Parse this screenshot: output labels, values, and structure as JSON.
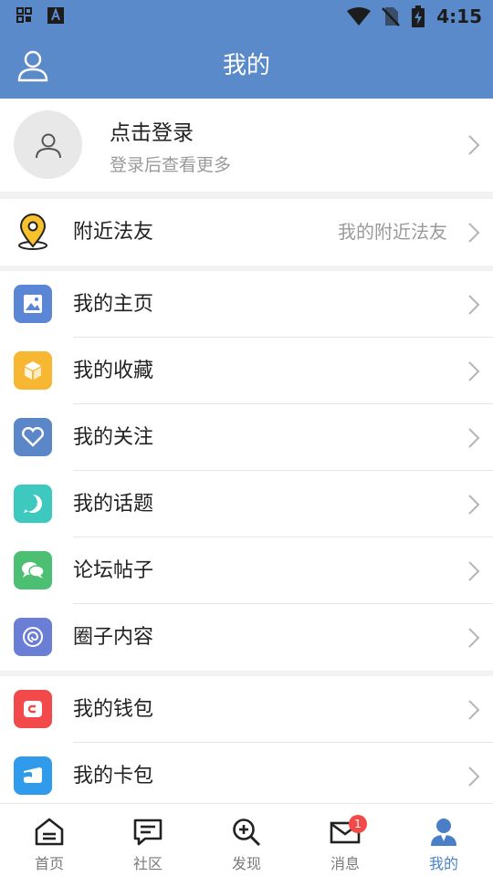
{
  "status": {
    "time": "4:15"
  },
  "header": {
    "title": "我的"
  },
  "login": {
    "title": "点击登录",
    "subtitle": "登录后查看更多"
  },
  "nearby": {
    "label": "附近法友",
    "sub": "我的附近法友"
  },
  "menu_group1": [
    {
      "label": "我的主页",
      "icon": "image-icon",
      "color": "#5b86d6"
    },
    {
      "label": "我的收藏",
      "icon": "box-icon",
      "color": "#f7b733"
    },
    {
      "label": "我的关注",
      "icon": "heart-icon",
      "color": "#5b86c8"
    },
    {
      "label": "我的话题",
      "icon": "hashtag-icon",
      "color": "#3ec9c0"
    },
    {
      "label": "论坛帖子",
      "icon": "chat-icon",
      "color": "#4cbf72"
    },
    {
      "label": "圈子内容",
      "icon": "spiral-icon",
      "color": "#6a7ed6"
    }
  ],
  "menu_group2": [
    {
      "label": "我的钱包",
      "icon": "wallet-icon",
      "color": "#f24a4a"
    },
    {
      "label": "我的卡包",
      "icon": "card-icon",
      "color": "#2f9bea"
    }
  ],
  "tabs": [
    {
      "label": "首页",
      "icon": "home-icon"
    },
    {
      "label": "社区",
      "icon": "community-icon"
    },
    {
      "label": "发现",
      "icon": "discover-icon"
    },
    {
      "label": "消息",
      "icon": "mail-icon",
      "badge": "1"
    },
    {
      "label": "我的",
      "icon": "profile-icon",
      "active": true
    }
  ]
}
